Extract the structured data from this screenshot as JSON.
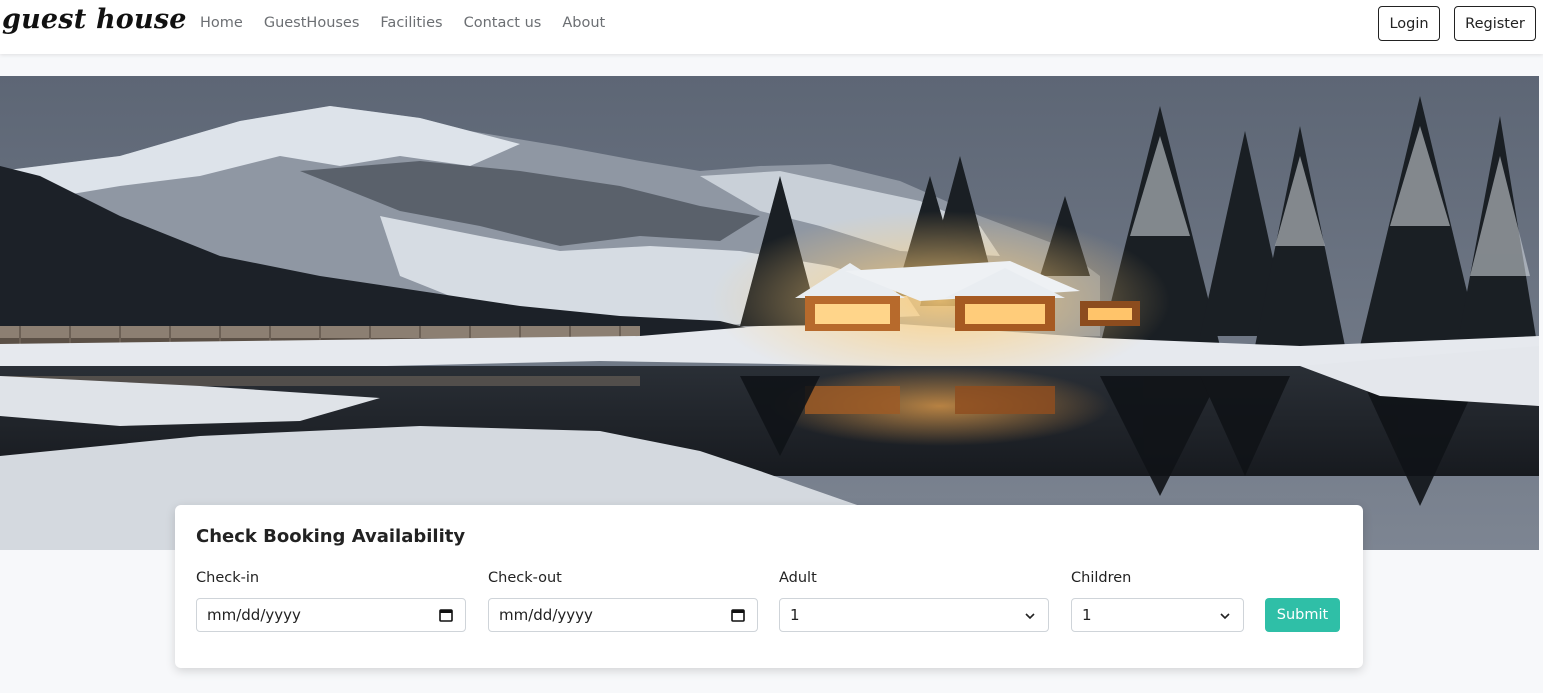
{
  "nav": {
    "brand": "guest house",
    "links": [
      {
        "label": "Home"
      },
      {
        "label": "GuestHouses"
      },
      {
        "label": "Facilities"
      },
      {
        "label": "Contact us"
      },
      {
        "label": "About"
      }
    ],
    "login_label": "Login",
    "register_label": "Register"
  },
  "hero": {
    "image": "snowy-lake-lodge-at-dusk"
  },
  "booking": {
    "title": "Check Booking Availability",
    "checkin_label": "Check-in",
    "checkin_value": "mm/dd/yyyy",
    "checkout_label": "Check-out",
    "checkout_value": "mm/dd/yyyy",
    "adult_label": "Adult",
    "adult_value": "1",
    "children_label": "Children",
    "children_value": "1",
    "submit_label": "Submit"
  },
  "colors": {
    "accent": "#2fbfa7",
    "page_bg": "#f7f8fa",
    "nav_text": "#6c6f73"
  }
}
